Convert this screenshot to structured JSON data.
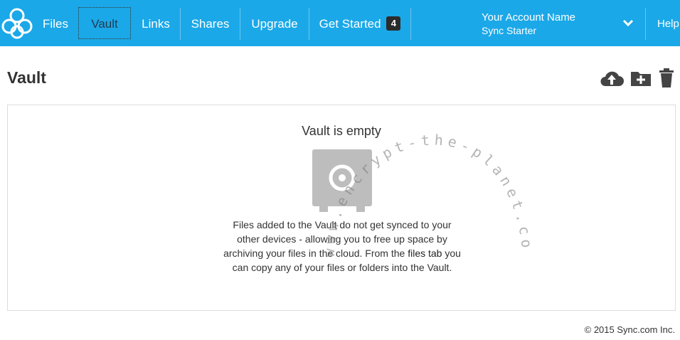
{
  "nav": {
    "items": [
      {
        "label": "Files"
      },
      {
        "label": "Vault"
      },
      {
        "label": "Links"
      },
      {
        "label": "Shares"
      },
      {
        "label": "Upgrade"
      },
      {
        "label": "Get Started",
        "badge": "4"
      }
    ],
    "account": {
      "name": "Your Account Name",
      "plan": "Sync Starter"
    },
    "help": "Help"
  },
  "page": {
    "title": "Vault"
  },
  "toolbar": {
    "upload_icon": "cloud-upload-icon",
    "new_folder_icon": "folder-plus-icon",
    "trash_icon": "trash-icon"
  },
  "empty": {
    "title": "Vault is empty",
    "text_before": "Files added to the Vault do not get synced to your other devices - allowing you to free up space by archiving your files in the cloud. From the ",
    "link": "files tab",
    "text_after": " you can copy any of your files or folders into the Vault."
  },
  "watermark": "www.encrypt-the-planet.com",
  "footer": {
    "copyright": "© 2015 Sync.com Inc."
  },
  "colors": {
    "brand": "#1ba8e8",
    "active_nav_text": "#1f3b52",
    "badge": "#2b2b2b",
    "icon": "#444444",
    "safe": "#bdbdbd"
  }
}
